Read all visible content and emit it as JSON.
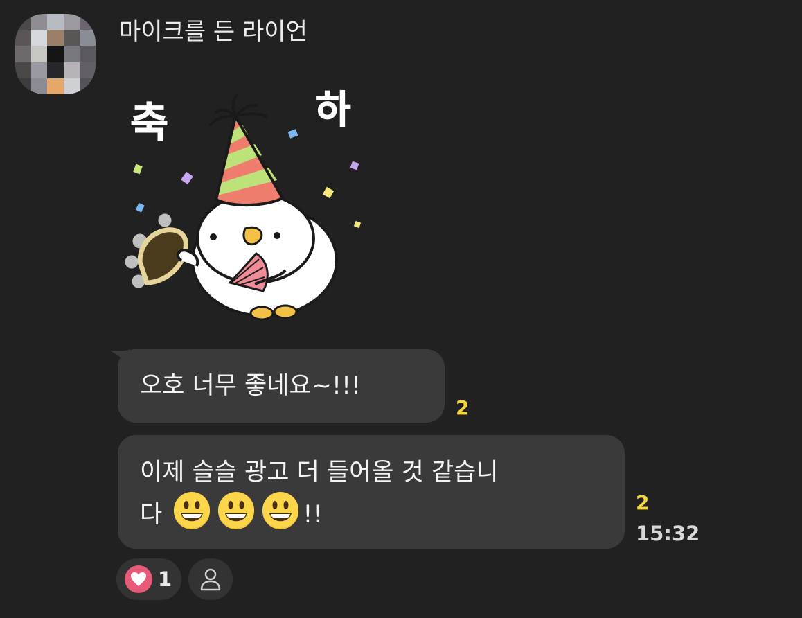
{
  "message": {
    "sender_name": "마이크를 든 라이언",
    "sticker": {
      "text_left": "축",
      "text_right": "하"
    },
    "bubbles": [
      {
        "text": "오호 너무 좋네요~!!!",
        "unread_count": "2"
      },
      {
        "line1": "이제 슬슬 광고 더 들어올 것 같습니",
        "line2_prefix": "다",
        "line2_suffix": "!!",
        "emoji": [
          "grinning-face",
          "grinning-face",
          "grinning-face"
        ],
        "unread_count": "2",
        "time": "15:32"
      }
    ]
  },
  "reactions": {
    "heart_count": "1",
    "heart_color": "#e85a7a",
    "add_icon": "person-outline-icon"
  },
  "colors": {
    "background": "#212121",
    "bubble": "#3a3a3a",
    "unread": "#f6d63c"
  }
}
